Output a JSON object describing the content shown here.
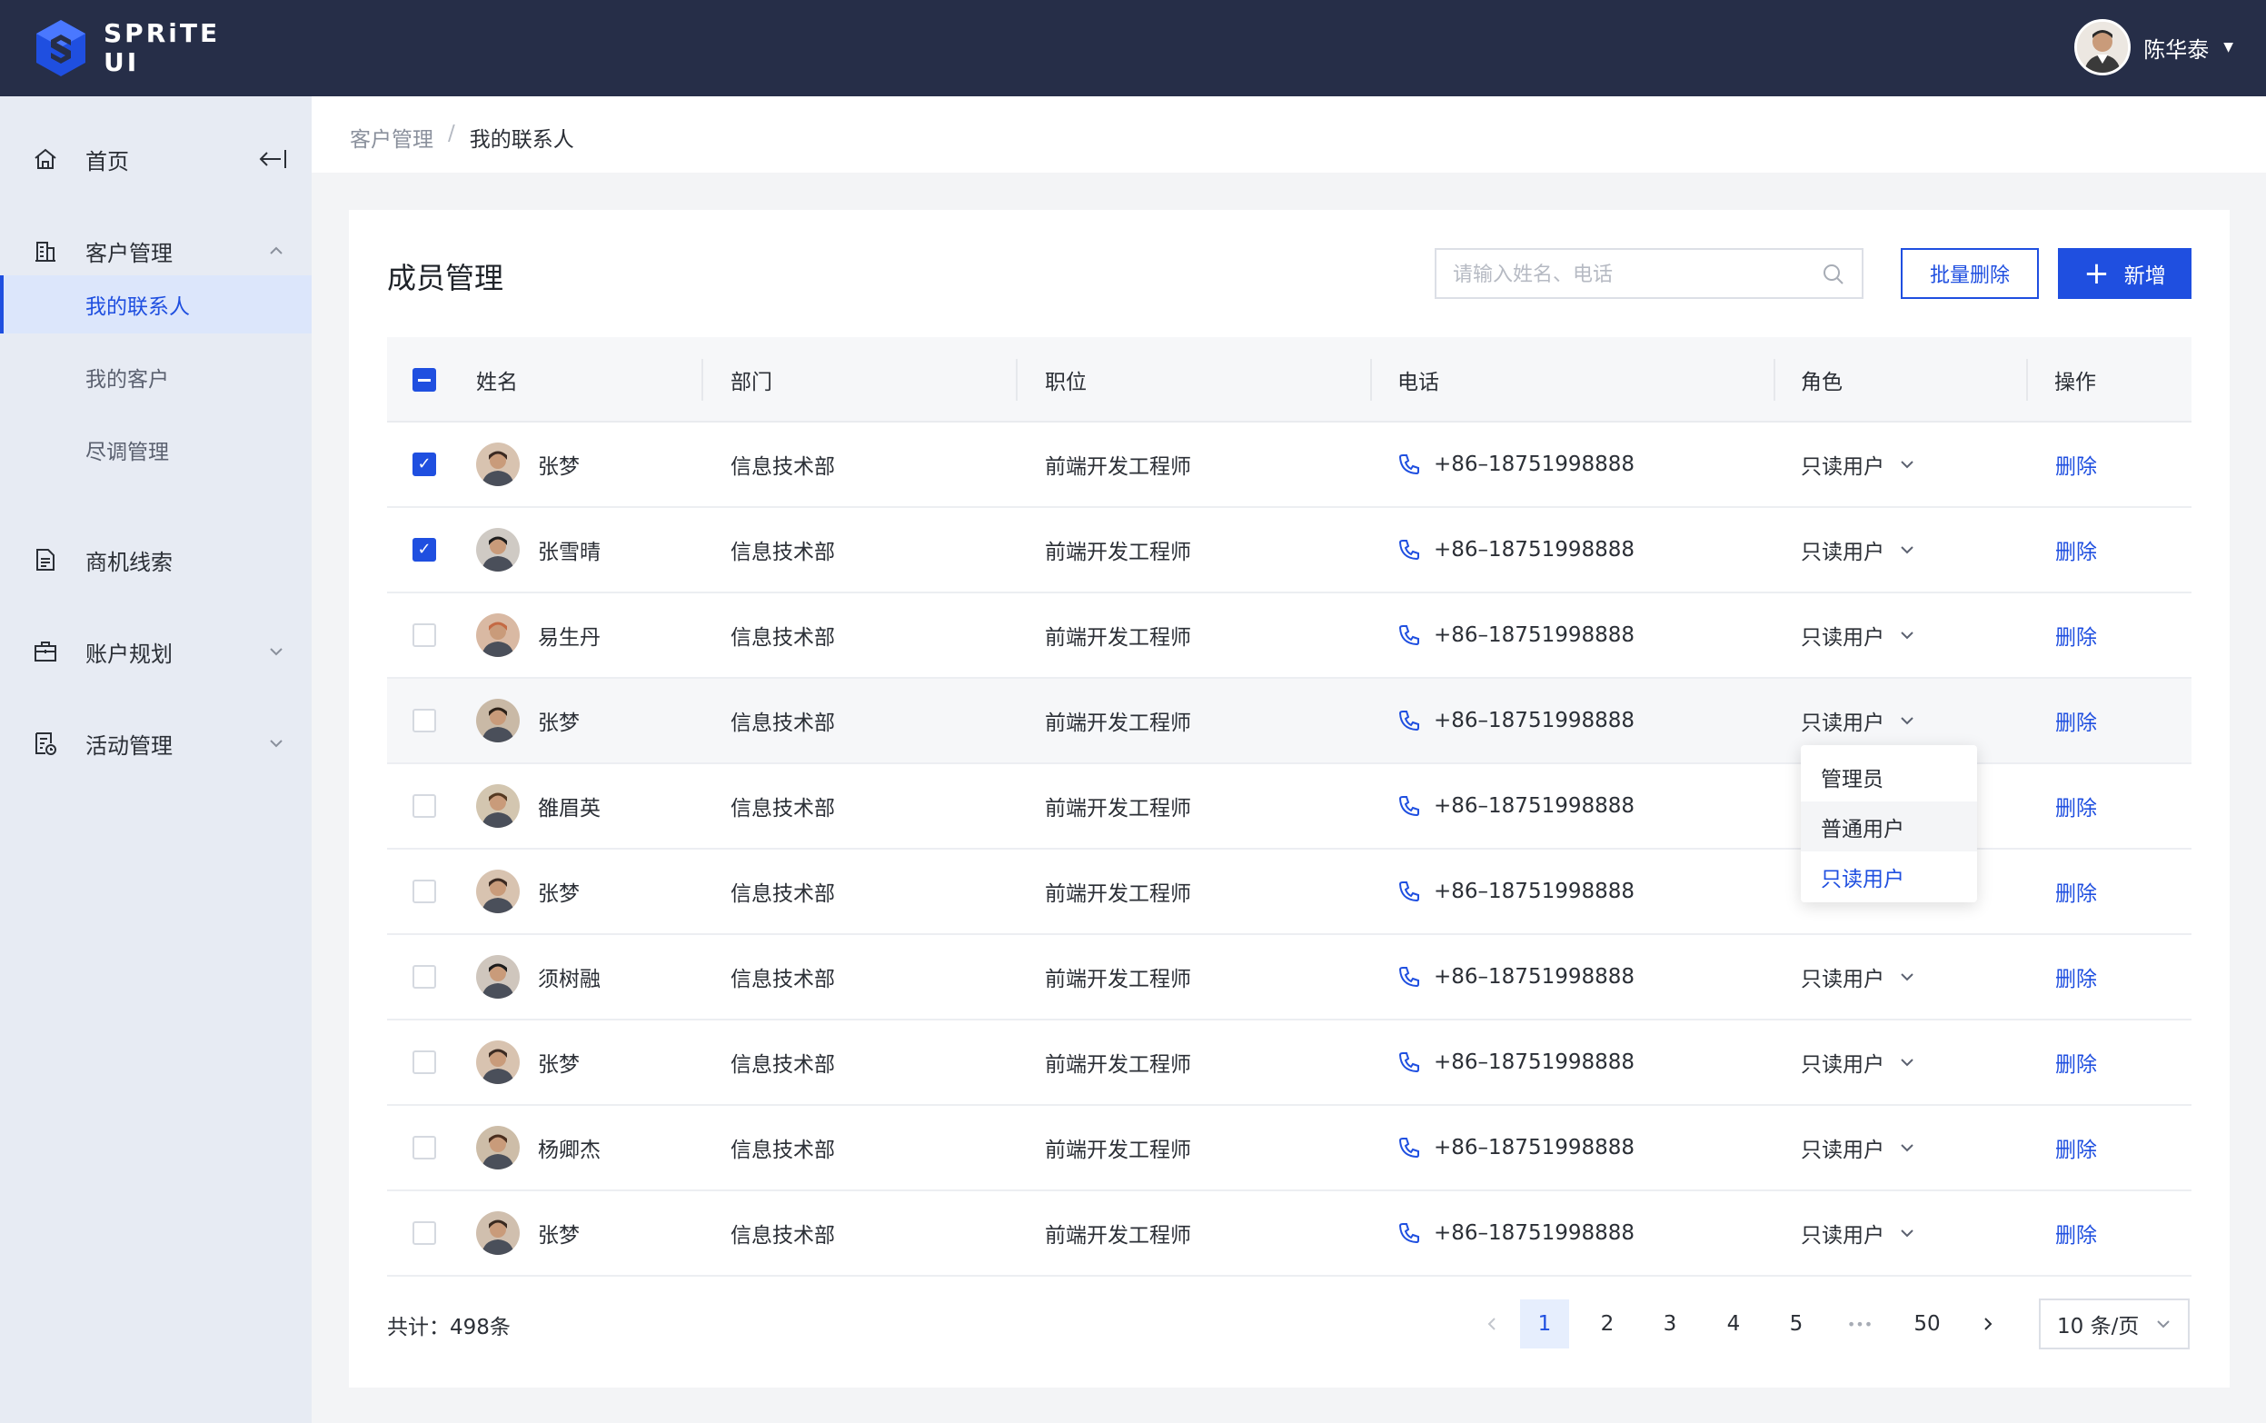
{
  "app": {
    "logo_line1": "SPRiTE",
    "logo_line2": "UI"
  },
  "user": {
    "name": "陈华泰"
  },
  "sidebar": {
    "items": [
      {
        "label": "首页",
        "icon": "home-icon"
      },
      {
        "label": "客户管理",
        "icon": "building-icon",
        "expanded": true
      },
      {
        "label": "商机线索",
        "icon": "document-icon"
      },
      {
        "label": "账户规划",
        "icon": "briefcase-icon"
      },
      {
        "label": "活动管理",
        "icon": "calendar-doc-icon"
      }
    ],
    "sub_items": [
      {
        "label": "我的联系人",
        "active": true
      },
      {
        "label": "我的客户",
        "active": false
      },
      {
        "label": "尽调管理",
        "active": false
      }
    ]
  },
  "breadcrumb": {
    "parent": "客户管理",
    "separator": "/",
    "current": "我的联系人"
  },
  "page": {
    "title": "成员管理",
    "search_placeholder": "请输入姓名、电话",
    "batch_delete_label": "批量删除",
    "add_label": "新增"
  },
  "table": {
    "columns": [
      "姓名",
      "部门",
      "职位",
      "电话",
      "角色",
      "操作"
    ],
    "rows": [
      {
        "name": "张梦",
        "dept": "信息技术部",
        "title": "前端开发工程师",
        "phone": "+86–18751998888",
        "role": "只读用户",
        "action": "删除",
        "checked": true
      },
      {
        "name": "张雪晴",
        "dept": "信息技术部",
        "title": "前端开发工程师",
        "phone": "+86–18751998888",
        "role": "只读用户",
        "action": "删除",
        "checked": true
      },
      {
        "name": "易生丹",
        "dept": "信息技术部",
        "title": "前端开发工程师",
        "phone": "+86–18751998888",
        "role": "只读用户",
        "action": "删除",
        "checked": false
      },
      {
        "name": "张梦",
        "dept": "信息技术部",
        "title": "前端开发工程师",
        "phone": "+86–18751998888",
        "role": "只读用户",
        "action": "删除",
        "checked": false
      },
      {
        "name": "雒眉英",
        "dept": "信息技术部",
        "title": "前端开发工程师",
        "phone": "+86–18751998888",
        "role": "",
        "action": "删除",
        "checked": false
      },
      {
        "name": "张梦",
        "dept": "信息技术部",
        "title": "前端开发工程师",
        "phone": "+86–18751998888",
        "role": "",
        "action": "删除",
        "checked": false
      },
      {
        "name": "须树融",
        "dept": "信息技术部",
        "title": "前端开发工程师",
        "phone": "+86–18751998888",
        "role": "只读用户",
        "action": "删除",
        "checked": false
      },
      {
        "name": "张梦",
        "dept": "信息技术部",
        "title": "前端开发工程师",
        "phone": "+86–18751998888",
        "role": "只读用户",
        "action": "删除",
        "checked": false
      },
      {
        "name": "杨卿杰",
        "dept": "信息技术部",
        "title": "前端开发工程师",
        "phone": "+86–18751998888",
        "role": "只读用户",
        "action": "删除",
        "checked": false
      },
      {
        "name": "张梦",
        "dept": "信息技术部",
        "title": "前端开发工程师",
        "phone": "+86–18751998888",
        "role": "只读用户",
        "action": "删除",
        "checked": false
      }
    ]
  },
  "role_dropdown": {
    "options": [
      "管理员",
      "普通用户",
      "只读用户"
    ],
    "selected": "只读用户"
  },
  "footer": {
    "total": "共计：498条",
    "pages": [
      "1",
      "2",
      "3",
      "4",
      "5",
      "•••",
      "50"
    ],
    "current_page": "1",
    "page_size": "10 条/页"
  },
  "colors": {
    "topbar": "#262e48",
    "accent": "#1f4fe0",
    "sidebar": "#e7ebf3"
  }
}
